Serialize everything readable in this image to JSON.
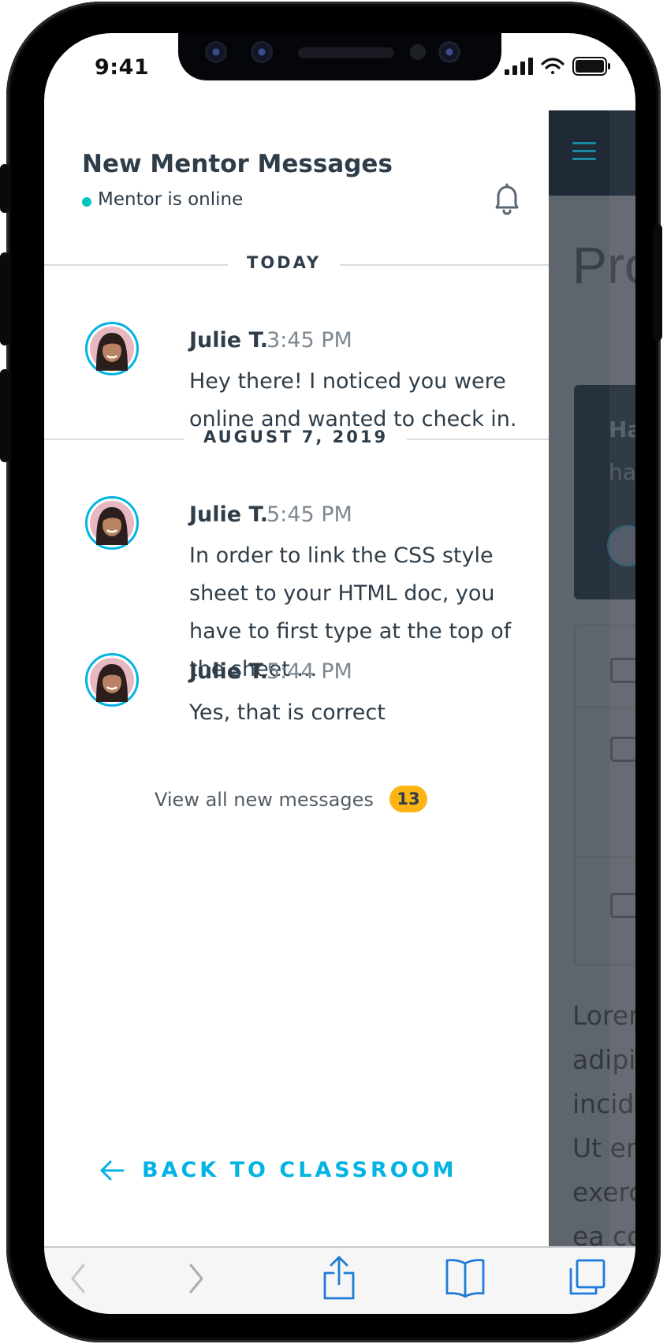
{
  "status_bar": {
    "time": "9:41"
  },
  "drawer": {
    "title": "New Mentor Messages",
    "status": "Mentor is online",
    "sections": [
      {
        "label": "TODAY"
      },
      {
        "label": "AUGUST 7, 2019"
      }
    ],
    "messages": [
      {
        "author": "Julie T.",
        "time": "3:45 PM",
        "body": "Hey there! I noticed you were online and wanted to check in."
      },
      {
        "author": "Julie T.",
        "time": "5:45 PM",
        "body": "In order to link the CSS style sheet to your HTML doc, you have to first type at the top of the sheet ..."
      },
      {
        "author": "Julie T.",
        "time": "5:44 PM",
        "body": "Yes, that is correct"
      }
    ],
    "view_all_label": "View all new messages",
    "unread_count": "13",
    "back_label": "BACK TO CLASSROOM"
  },
  "page_behind": {
    "title": "Pro",
    "card_line1": "Ha",
    "card_line2": "ha",
    "text_lines": [
      "Lorem",
      "adipis",
      "incidi",
      "Ut en",
      "exerc",
      "ea co"
    ]
  },
  "colors": {
    "accent": "#02b3e4",
    "online": "#02c7be",
    "badge": "#fcb414",
    "text": "#2e3d49"
  },
  "icons": [
    "bell-icon",
    "back-arrow-icon",
    "safari-back-icon",
    "safari-forward-icon",
    "share-icon",
    "bookmarks-icon",
    "tabs-icon"
  ]
}
